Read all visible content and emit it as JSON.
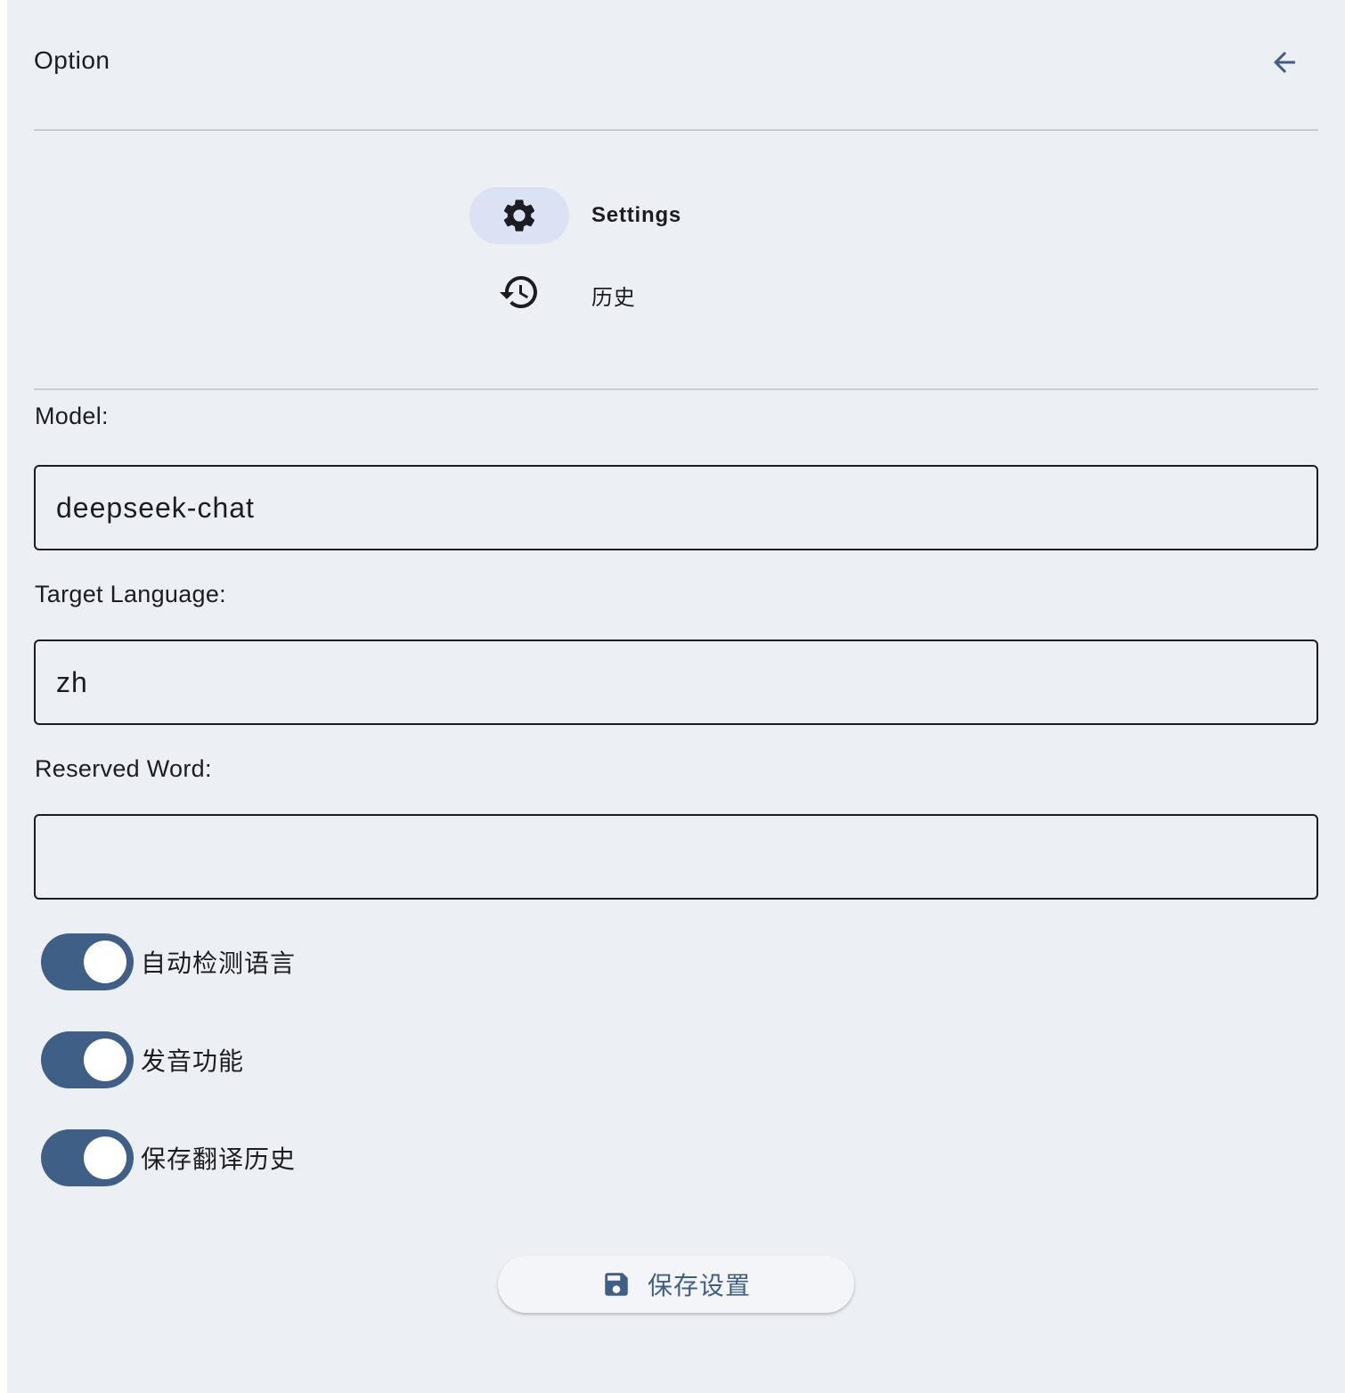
{
  "header": {
    "title": "Option",
    "back_icon": "arrow-back-icon"
  },
  "nav": {
    "items": [
      {
        "label": "Settings",
        "icon": "gear-icon",
        "active": true
      },
      {
        "label": "历史",
        "icon": "history-icon",
        "active": false
      }
    ]
  },
  "form": {
    "model_label": "Model:",
    "model_value": "deepseek-chat",
    "target_language_label": "Target Language:",
    "target_language_value": "zh",
    "reserved_word_label": "Reserved Word:",
    "reserved_word_value": ""
  },
  "toggles": [
    {
      "label": "自动检测语言",
      "on": true
    },
    {
      "label": "发音功能",
      "on": true
    },
    {
      "label": "保存翻译历史",
      "on": true
    }
  ],
  "save_button": {
    "label": "保存设置",
    "icon": "save-icon"
  },
  "colors": {
    "background": "#eceff3",
    "accent": "#3f5f87",
    "nav_active_bg": "#dae2f4"
  }
}
